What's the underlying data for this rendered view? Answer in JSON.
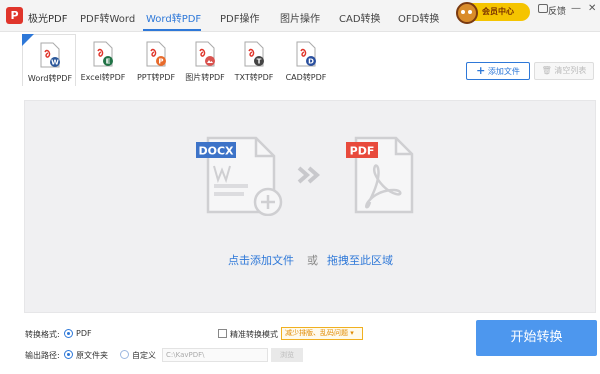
{
  "app": {
    "logo_text": "P",
    "name": "极光PDF"
  },
  "nav": {
    "tabs": [
      {
        "label": "PDF转Word"
      },
      {
        "label": "Word转PDF"
      },
      {
        "label": "PDF操作"
      },
      {
        "label": "图片操作"
      },
      {
        "label": "CAD转换"
      },
      {
        "label": "OFD转换"
      }
    ],
    "active_tab": "Word转PDF"
  },
  "header": {
    "member_label": "会员中心",
    "feedback_label": "反馈",
    "minimize_glyph": "—",
    "close_glyph": "✕"
  },
  "tools": [
    {
      "label": "Word转PDF",
      "badge_letter": "W",
      "badge_color": "#2b579a",
      "active": true
    },
    {
      "label": "Excel转PDF",
      "badge_letter": "E",
      "badge_color": "#217346"
    },
    {
      "label": "PPT转PDF",
      "badge_letter": "P",
      "badge_color": "#e86b2c"
    },
    {
      "label": "图片转PDF",
      "badge_letter": "▲",
      "badge_color": "#d9534f"
    },
    {
      "label": "TXT转PDF",
      "badge_letter": "T",
      "badge_color": "#444444"
    },
    {
      "label": "CAD转PDF",
      "badge_letter": "D",
      "badge_color": "#2a4f9e"
    }
  ],
  "actions": {
    "add_file": "添加文件",
    "clear_list": "清空列表"
  },
  "drop_area": {
    "source_tag": "DOCX",
    "target_tag": "PDF",
    "click_add": "点击添加文件",
    "or": "或",
    "drag_here": "拖拽至此区域"
  },
  "options": {
    "format_label": "转换格式:",
    "format_value": "PDF",
    "precise_label": "精准转换模式",
    "precise_dropdown": "减少排版、乱码问题 ▾",
    "output_label": "输出路径:",
    "source_folder": "原文件夹",
    "custom": "自定义",
    "path_value": "C:\\KavPDF\\",
    "browse": "浏览"
  },
  "start_button": "开始转换",
  "colors": {
    "accent": "#2e78d8",
    "start": "#4d97ee",
    "docx_tag": "#3d73c8",
    "pdf_tag": "#e84a3c",
    "drop_bg": "#f0f0f2"
  }
}
